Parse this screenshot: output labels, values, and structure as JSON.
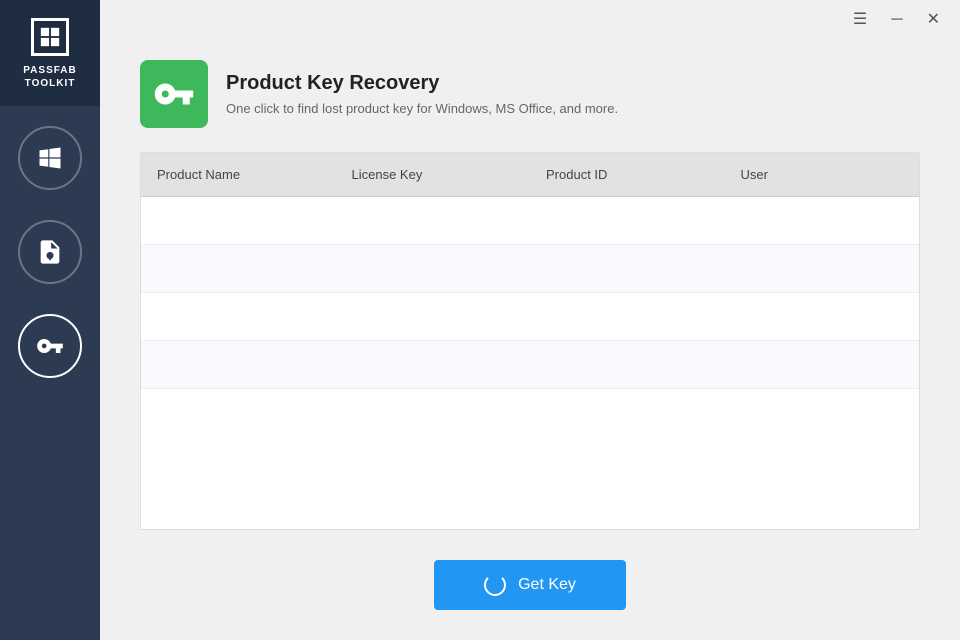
{
  "sidebar": {
    "logo_line1": "PASSFAB",
    "logo_line2": "TOOLKIT",
    "items": [
      {
        "id": "windows",
        "label": "Windows"
      },
      {
        "id": "file-key",
        "label": "File Key"
      },
      {
        "id": "product-key",
        "label": "Product Key"
      }
    ]
  },
  "titlebar": {
    "menu_icon": "☰",
    "minimize_icon": "─",
    "close_icon": "✕"
  },
  "header": {
    "title": "Product Key Recovery",
    "subtitle": "One click to find lost product key for Windows, MS Office, and more."
  },
  "table": {
    "columns": [
      "Product Name",
      "License Key",
      "Product ID",
      "User"
    ],
    "rows": [
      [
        "",
        "",
        "",
        ""
      ],
      [
        "",
        "",
        "",
        ""
      ],
      [
        "",
        "",
        "",
        ""
      ],
      [
        "",
        "",
        "",
        ""
      ],
      [
        "",
        "",
        "",
        ""
      ]
    ]
  },
  "button": {
    "label": "Get Key"
  },
  "colors": {
    "sidebar_bg": "#2c3a52",
    "sidebar_header_bg": "#1e2d42",
    "accent_green": "#3db85a",
    "accent_blue": "#2196f3",
    "table_header_bg": "#e2e2e2"
  }
}
